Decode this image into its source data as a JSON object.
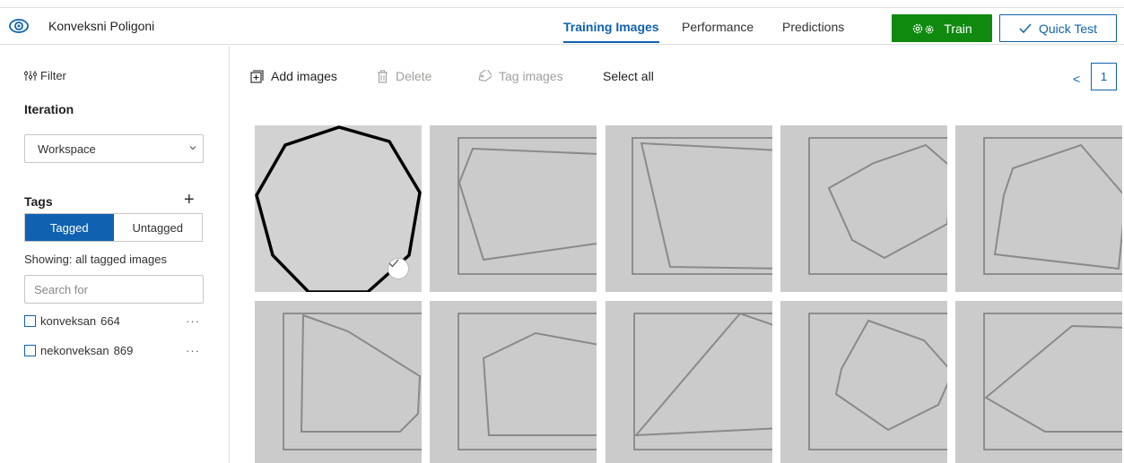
{
  "header": {
    "project_name": "Konveksni Poligoni",
    "tabs": [
      {
        "label": "Training Images",
        "active": true
      },
      {
        "label": "Performance",
        "active": false
      },
      {
        "label": "Predictions",
        "active": false
      }
    ],
    "train_label": "Train",
    "quick_test_label": "Quick Test",
    "accent_color": "#0f62b0",
    "train_color": "#0f8a0f"
  },
  "sidebar": {
    "filter_label": "Filter",
    "iteration_heading": "Iteration",
    "iteration_selected": "Workspace",
    "tags_heading": "Tags",
    "add_tag_symbol": "+",
    "toggle": {
      "tagged": "Tagged",
      "untagged": "Untagged"
    },
    "showing_text": "Showing: all tagged images",
    "search_placeholder": "Search for",
    "tags": [
      {
        "name": "konveksan",
        "count": "664"
      },
      {
        "name": "nekonveksan",
        "count": "869"
      }
    ],
    "more_symbol": "···"
  },
  "toolbar": {
    "add_images": "Add images",
    "delete": "Delete",
    "tag_images": "Tag images",
    "select_all": "Select all",
    "pager_prev": "<",
    "page_number": "1"
  },
  "images": {
    "count": 10,
    "first_selected": true,
    "icons": [
      "eye-icon",
      "filter-icon",
      "chevron-down-icon",
      "add-images-icon",
      "trash-icon",
      "tag-icon",
      "gear-icon",
      "checkmark-icon"
    ]
  }
}
